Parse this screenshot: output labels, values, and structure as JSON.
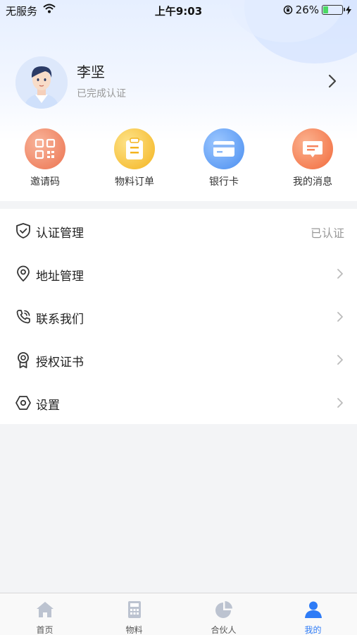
{
  "status_bar": {
    "carrier": "无服务",
    "time": "上午9:03",
    "battery": "26%",
    "battery_level": 0.26
  },
  "profile": {
    "name": "李坚",
    "status": "已完成认证"
  },
  "quick_actions": [
    {
      "label": "邀请码",
      "icon": "qr-code-icon",
      "color": "#f08a6a"
    },
    {
      "label": "物料订单",
      "icon": "clipboard-icon",
      "color": "#f7c13a"
    },
    {
      "label": "银行卡",
      "icon": "bank-card-icon",
      "color": "#5a9cf5"
    },
    {
      "label": "我的消息",
      "icon": "message-icon",
      "color": "#f6845c"
    }
  ],
  "menu": [
    {
      "label": "认证管理",
      "icon": "shield-check-icon",
      "right_text": "已认证"
    },
    {
      "label": "地址管理",
      "icon": "location-pin-icon",
      "right_text": ""
    },
    {
      "label": "联系我们",
      "icon": "phone-icon",
      "right_text": ""
    },
    {
      "label": "授权证书",
      "icon": "certificate-icon",
      "right_text": ""
    },
    {
      "label": "设置",
      "icon": "settings-icon",
      "right_text": ""
    }
  ],
  "tabbar": {
    "active_color": "#2f7cf6",
    "inactive_color": "#bcc3d0",
    "tabs": [
      {
        "label": "首页",
        "icon": "home-icon",
        "active": false
      },
      {
        "label": "物料",
        "icon": "calculator-icon",
        "active": false
      },
      {
        "label": "合伙人",
        "icon": "pie-chart-icon",
        "active": false
      },
      {
        "label": "我的",
        "icon": "user-icon",
        "active": true
      }
    ]
  }
}
